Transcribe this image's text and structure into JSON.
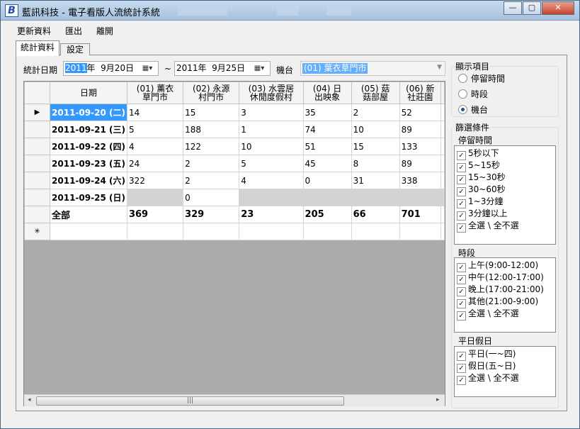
{
  "window": {
    "title": "藍訊科技 - 電子看版人流統計系統",
    "icon_letter": "B",
    "min_glyph": "—",
    "max_glyph": "▢",
    "close_glyph": "✕"
  },
  "menu": [
    "更新資料",
    "匯出",
    "離開"
  ],
  "tabs": [
    "統計資料",
    "設定"
  ],
  "filter": {
    "date_label": "統計日期",
    "start_year": "2011",
    "start_rest": "年  9月20日",
    "tilde": "~",
    "end_date": "2011年  9月25日",
    "machine_label": "機台",
    "machine_value": "(01) 葉衣草門市"
  },
  "grid": {
    "columns": [
      "日期",
      "(01) 薰衣\n草門市",
      "(02) 永源\n村門市",
      "(03) 水雲居\n休閒度假村",
      "(04) 日\n出映象",
      "(05) 菇\n菇部屋",
      "(06) 新\n社莊園"
    ],
    "rows": [
      {
        "date": "2011-09-20 (二)",
        "values": [
          "14",
          "15",
          "3",
          "35",
          "2",
          "52"
        ],
        "selected": true
      },
      {
        "date": "2011-09-21 (三)",
        "values": [
          "5",
          "188",
          "1",
          "74",
          "10",
          "89"
        ]
      },
      {
        "date": "2011-09-22 (四)",
        "values": [
          "4",
          "122",
          "10",
          "51",
          "15",
          "133"
        ]
      },
      {
        "date": "2011-09-23 (五)",
        "values": [
          "24",
          "2",
          "5",
          "45",
          "8",
          "89"
        ]
      },
      {
        "date": "2011-09-24 (六)",
        "values": [
          "322",
          "2",
          "4",
          "0",
          "31",
          "338"
        ]
      },
      {
        "date": "2011-09-25 (日)",
        "values": [
          "",
          "0",
          "",
          "",
          "",
          ""
        ]
      }
    ],
    "total": {
      "label": "全部",
      "values": [
        "369",
        "329",
        "23",
        "205",
        "66",
        "701"
      ]
    },
    "current_row_glyph": "▶",
    "new_row_glyph": "✳",
    "scroll_left": "◂",
    "scroll_right": "▸",
    "scroll_grip": "|||"
  },
  "display": {
    "title": "顯示項目",
    "options": [
      "停留時間",
      "時段",
      "機台"
    ],
    "selected": "機台"
  },
  "filters_title": "篩選條件",
  "dwell": {
    "title": "停留時間",
    "items": [
      "5秒以下",
      "5~15秒",
      "15~30秒",
      "30~60秒",
      "1~3分鐘",
      "3分鐘以上",
      "全選 \\ 全不選"
    ]
  },
  "period": {
    "title": "時段",
    "items": [
      "上午(9:00-12:00)",
      "中午(12:00-17:00)",
      "晚上(17:00-21:00)",
      "其他(21:00-9:00)",
      "全選 \\ 全不選"
    ]
  },
  "daytype": {
    "title": "平日假日",
    "items": [
      "平日(一~四)",
      "假日(五~日)",
      "全選 \\ 全不選"
    ]
  },
  "check_glyph": "✓"
}
